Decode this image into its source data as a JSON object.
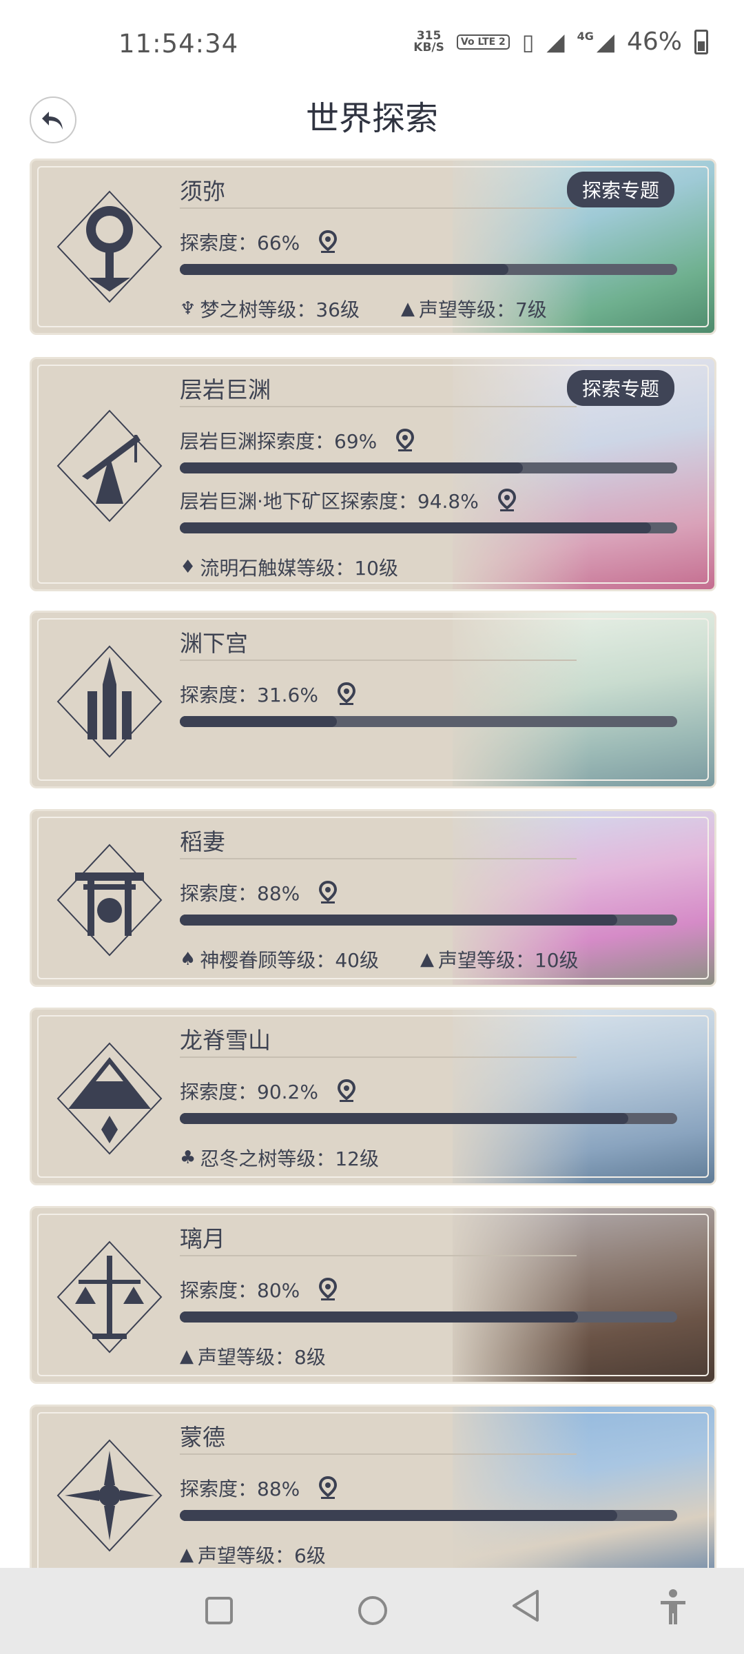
{
  "status_bar": {
    "time": "11:54:34",
    "net_speed_value": "315",
    "net_speed_unit": "KB/S",
    "volte": "Vo LTE 2",
    "network": "4G",
    "battery": "46%"
  },
  "header": {
    "title": "世界探索",
    "back_icon": "back-arrow-icon"
  },
  "regions": [
    {
      "name": "须弥",
      "topic_button": "探索专题",
      "progress": [
        {
          "label": "探索度：66%",
          "value": 0.66
        }
      ],
      "levels": [
        {
          "icon": "dream-tree-icon",
          "text": "梦之树等级：36级"
        },
        {
          "icon": "reputation-icon",
          "text": "声望等级：7级"
        }
      ],
      "accent": "#6fb5c9"
    },
    {
      "name": "层岩巨渊",
      "topic_button": "探索专题",
      "progress": [
        {
          "label": "层岩巨渊探索度：69%",
          "value": 0.69
        },
        {
          "label": "层岩巨渊·地下矿区探索度：94.8%",
          "value": 0.948
        }
      ],
      "levels": [
        {
          "icon": "lumenstone-icon",
          "text": "流明石触媒等级：10级"
        }
      ],
      "accent": "#c98fa8"
    },
    {
      "name": "渊下宫",
      "progress": [
        {
          "label": "探索度：31.6%",
          "value": 0.316
        }
      ],
      "levels": [],
      "accent": "#a7c2bd"
    },
    {
      "name": "稻妻",
      "progress": [
        {
          "label": "探索度：88%",
          "value": 0.88
        }
      ],
      "levels": [
        {
          "icon": "sacred-sakura-icon",
          "text": "神樱眷顾等级：40级"
        },
        {
          "icon": "reputation-icon",
          "text": "声望等级：10级"
        }
      ],
      "accent": "#d89ac8"
    },
    {
      "name": "龙脊雪山",
      "progress": [
        {
          "label": "探索度：90.2%",
          "value": 0.902
        }
      ],
      "levels": [
        {
          "icon": "frostbearing-tree-icon",
          "text": "忍冬之树等级：12级"
        }
      ],
      "accent": "#8fa8c2"
    },
    {
      "name": "璃月",
      "progress": [
        {
          "label": "探索度：80%",
          "value": 0.8
        }
      ],
      "levels": [
        {
          "icon": "reputation-icon",
          "text": "声望等级：8级"
        }
      ],
      "accent": "#8a6b58"
    },
    {
      "name": "蒙德",
      "progress": [
        {
          "label": "探索度：88%",
          "value": 0.88
        }
      ],
      "levels": [
        {
          "icon": "reputation-icon",
          "text": "声望等级：6级"
        }
      ],
      "accent": "#7fa8d0"
    }
  ],
  "nav_bar": {
    "buttons": [
      "recent-apps-icon",
      "home-icon",
      "back-icon",
      "accessibility-icon"
    ]
  }
}
